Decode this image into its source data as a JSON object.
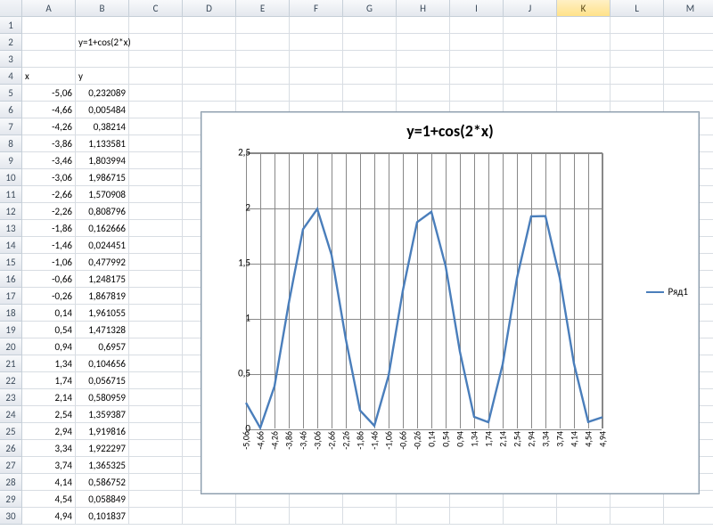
{
  "columns": [
    "A",
    "B",
    "C",
    "D",
    "E",
    "F",
    "G",
    "H",
    "I",
    "J",
    "K",
    "L",
    "M"
  ],
  "selected_col": "K",
  "formula_label": "y=1+cos(2*x)",
  "headers": {
    "x": "x",
    "y": "y"
  },
  "rows": [
    {
      "r": 5,
      "x": "-5,06",
      "y": "0,232089"
    },
    {
      "r": 6,
      "x": "-4,66",
      "y": "0,005484"
    },
    {
      "r": 7,
      "x": "-4,26",
      "y": "0,38214"
    },
    {
      "r": 8,
      "x": "-3,86",
      "y": "1,133581"
    },
    {
      "r": 9,
      "x": "-3,46",
      "y": "1,803994"
    },
    {
      "r": 10,
      "x": "-3,06",
      "y": "1,986715"
    },
    {
      "r": 11,
      "x": "-2,66",
      "y": "1,570908"
    },
    {
      "r": 12,
      "x": "-2,26",
      "y": "0,808796"
    },
    {
      "r": 13,
      "x": "-1,86",
      "y": "0,162666"
    },
    {
      "r": 14,
      "x": "-1,46",
      "y": "0,024451"
    },
    {
      "r": 15,
      "x": "-1,06",
      "y": "0,477992"
    },
    {
      "r": 16,
      "x": "-0,66",
      "y": "1,248175"
    },
    {
      "r": 17,
      "x": "-0,26",
      "y": "1,867819"
    },
    {
      "r": 18,
      "x": "0,14",
      "y": "1,961055"
    },
    {
      "r": 19,
      "x": "0,54",
      "y": "1,471328"
    },
    {
      "r": 20,
      "x": "0,94",
      "y": "0,6957"
    },
    {
      "r": 21,
      "x": "1,34",
      "y": "0,104656"
    },
    {
      "r": 22,
      "x": "1,74",
      "y": "0,056715"
    },
    {
      "r": 23,
      "x": "2,14",
      "y": "0,580959"
    },
    {
      "r": 24,
      "x": "2,54",
      "y": "1,359387"
    },
    {
      "r": 25,
      "x": "2,94",
      "y": "1,919816"
    },
    {
      "r": 26,
      "x": "3,34",
      "y": "1,922297"
    },
    {
      "r": 27,
      "x": "3,74",
      "y": "1,365325"
    },
    {
      "r": 28,
      "x": "4,14",
      "y": "0,586752"
    },
    {
      "r": 29,
      "x": "4,54",
      "y": "0,058849"
    },
    {
      "r": 30,
      "x": "4,94",
      "y": "0,101837"
    }
  ],
  "chart_data": {
    "type": "line",
    "title": "y=1+cos(2*x)",
    "ylim": [
      0,
      2.5
    ],
    "yticks": [
      0,
      0.5,
      1,
      1.5,
      2,
      2.5
    ],
    "yticklabels": [
      "0",
      "0,5",
      "1",
      "1,5",
      "2",
      "2,5"
    ],
    "xticklabels": [
      "-5,06",
      "-4,66",
      "-4,26",
      "-3,86",
      "-3,46",
      "-3,06",
      "-2,66",
      "-2,26",
      "-1,86",
      "-1,46",
      "-1,06",
      "-0,66",
      "-0,26",
      "0,14",
      "0,54",
      "0,94",
      "1,34",
      "1,74",
      "2,14",
      "2,54",
      "2,94",
      "3,34",
      "3,74",
      "4,14",
      "4,54",
      "4,94"
    ],
    "series": [
      {
        "name": "Ряд1",
        "values": [
          0.232089,
          0.005484,
          0.38214,
          1.133581,
          1.803994,
          1.986715,
          1.570908,
          0.808796,
          0.162666,
          0.024451,
          0.477992,
          1.248175,
          1.867819,
          1.961055,
          1.471328,
          0.6957,
          0.104656,
          0.056715,
          0.580959,
          1.359387,
          1.919816,
          1.922297,
          1.365325,
          0.586752,
          0.058849,
          0.101837
        ]
      }
    ],
    "legend_position": "right"
  }
}
